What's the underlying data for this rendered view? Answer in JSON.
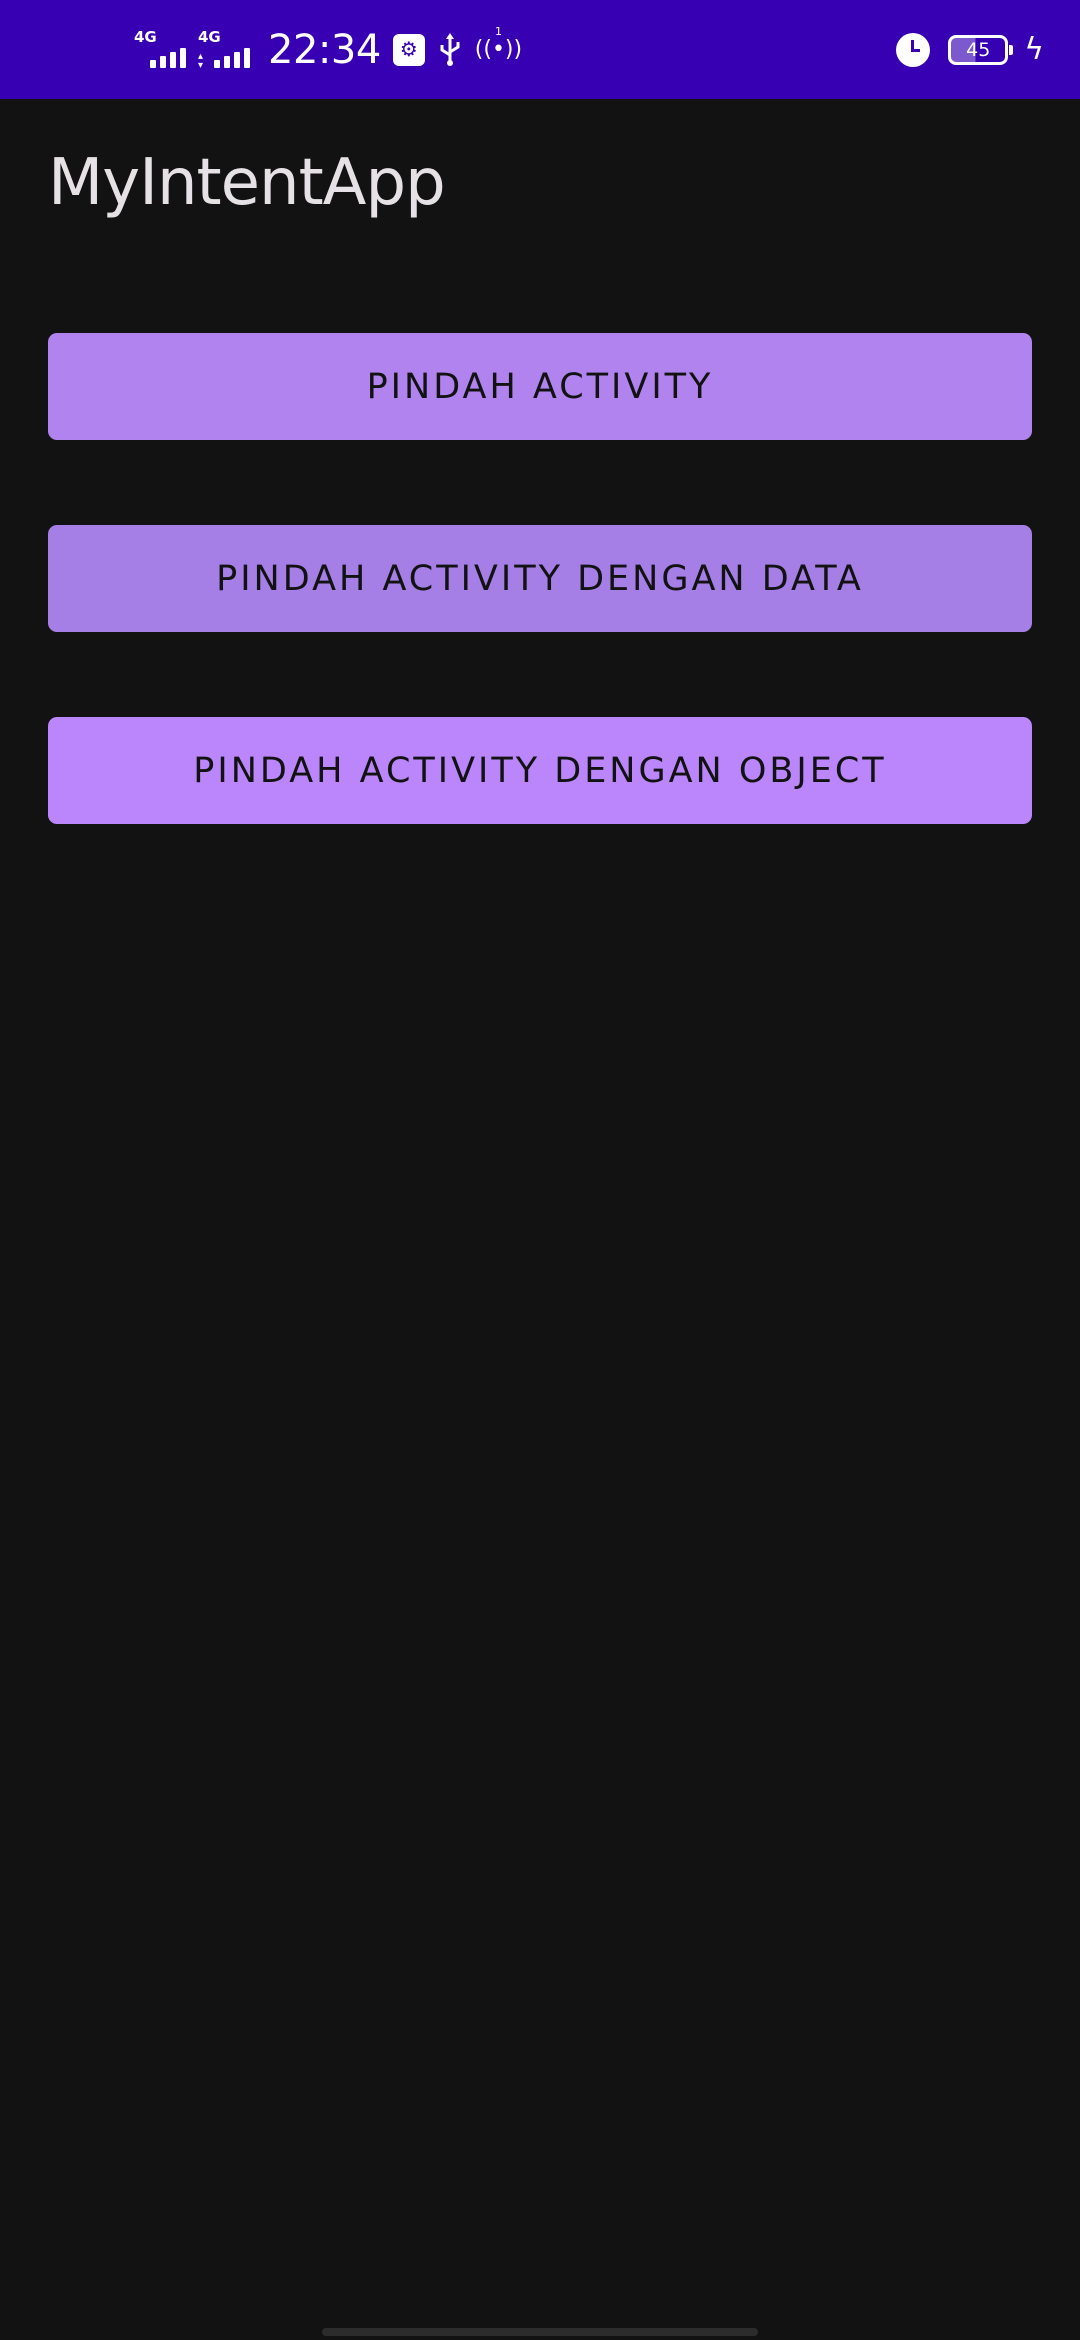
{
  "status_bar": {
    "sim1_label": "4G",
    "sim2_label": "4G",
    "time": "22:34",
    "hotspot_number": "1",
    "battery_level": "45",
    "background_color": "#3700b3"
  },
  "app": {
    "title": "MyIntentApp"
  },
  "buttons": [
    {
      "label": "PINDAH ACTIVITY"
    },
    {
      "label": "PINDAH ACTIVITY DENGAN DATA"
    },
    {
      "label": "PINDAH ACTIVITY DENGAN OBJECT"
    }
  ],
  "colors": {
    "accent": "#bb86fc",
    "background": "#121212",
    "primary_dark": "#3700b3"
  },
  "icons": [
    "signal-4g-icon",
    "usb-settings-icon",
    "usb-icon",
    "hotspot-icon",
    "alarm-icon",
    "battery-icon",
    "charging-icon"
  ]
}
